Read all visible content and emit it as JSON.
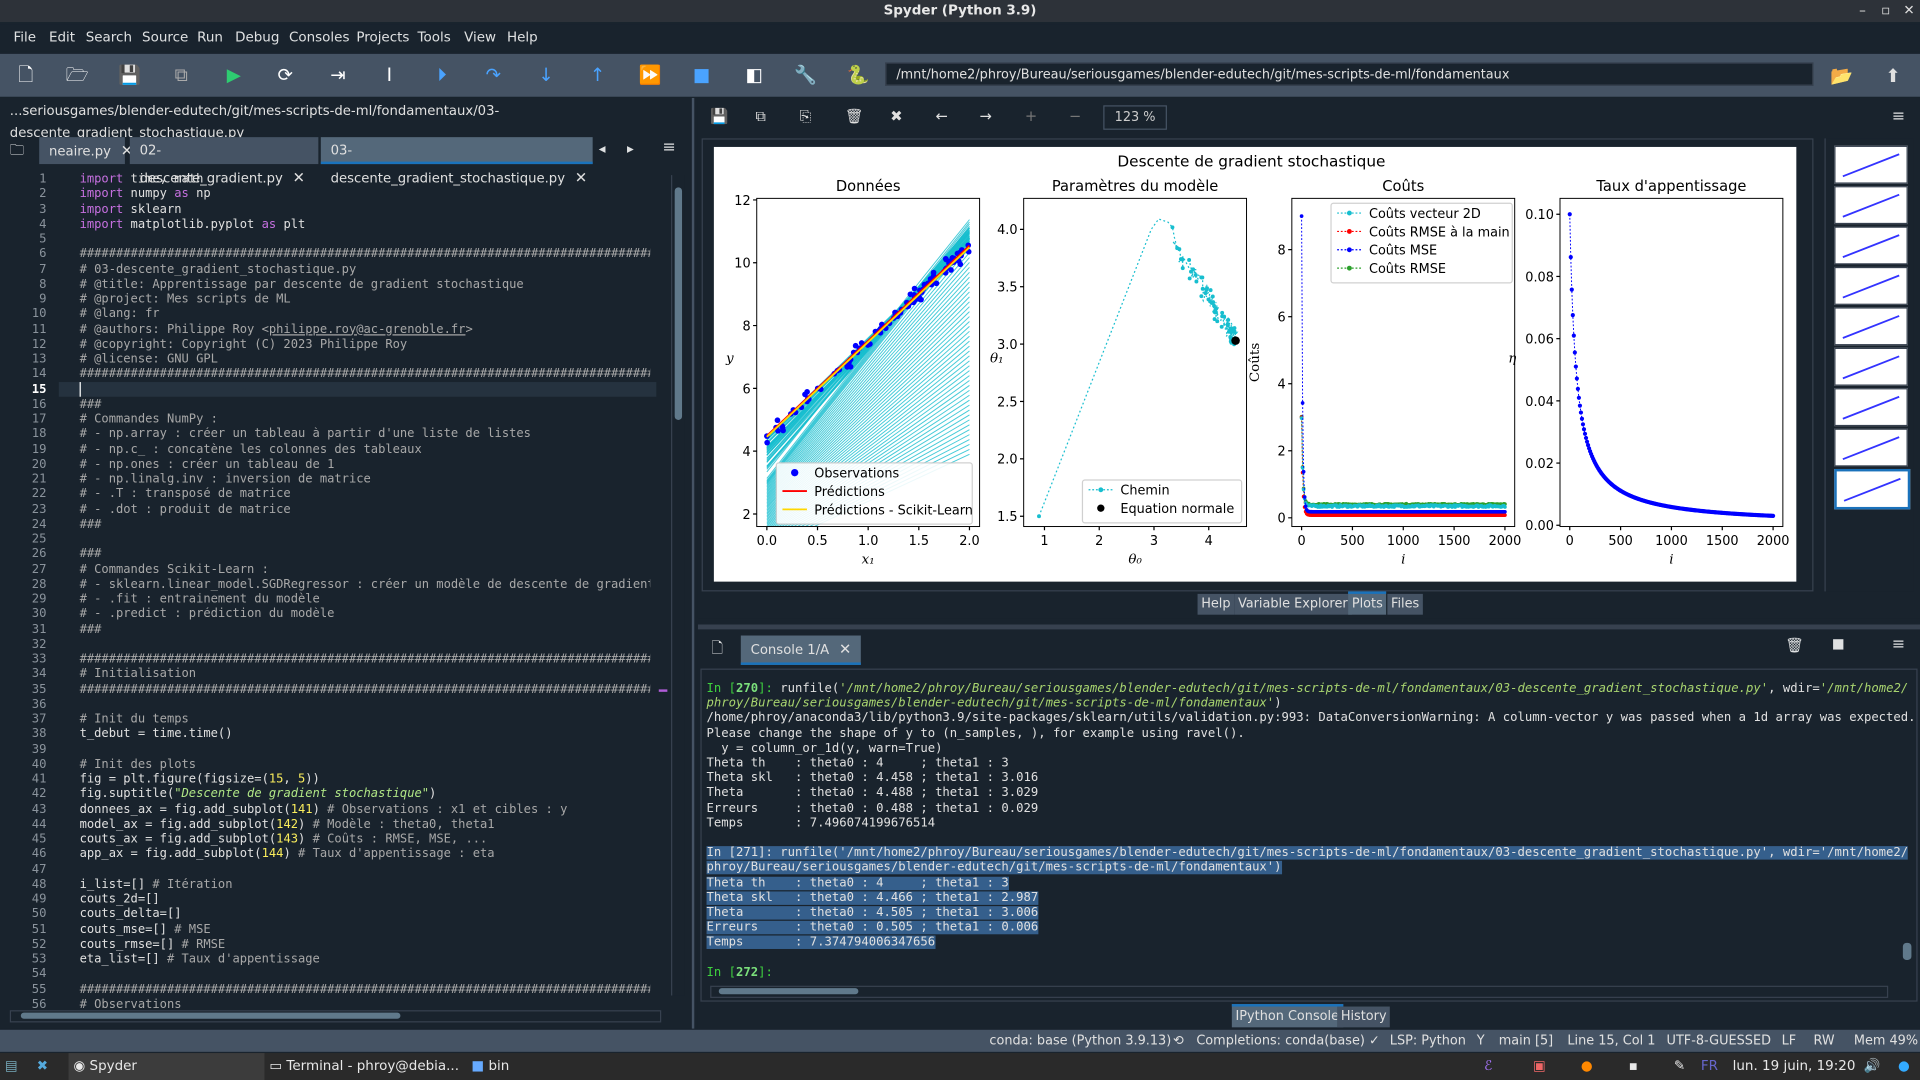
{
  "window": {
    "title": "Spyder (Python 3.9)"
  },
  "menu": [
    "File",
    "Edit",
    "Search",
    "Source",
    "Run",
    "Debug",
    "Consoles",
    "Projects",
    "Tools",
    "View",
    "Help"
  ],
  "toolbar": {
    "path": "/mnt/home2/phroy/Bureau/seriousgames/blender-edutech/git/mes-scripts-de-ml/fondamentaux",
    "icons": [
      "new-file-icon",
      "open-file-icon",
      "save-icon",
      "save-all-icon",
      "run-icon",
      "run-cell-icon",
      "run-cell-advance-icon",
      "run-selection-icon",
      "debug-icon",
      "step-icon",
      "step-into-icon",
      "step-return-icon",
      "continue-icon",
      "stop-icon",
      "maximize-pane-icon",
      "preferences-icon",
      "python-path-icon"
    ]
  },
  "editor": {
    "file_path": "...seriousgames/blender-edutech/git/mes-scripts-de-ml/fondamentaux/03-descente_gradient_stochastique.py",
    "tabs": [
      {
        "label": "neaire.py"
      },
      {
        "label": "02-descente_gradient.py"
      },
      {
        "label": "03-descente_gradient_stochastique.py",
        "active": true
      }
    ],
    "current_line": 15,
    "lines": [
      "import time, math",
      "import numpy as np",
      "import sklearn",
      "import matplotlib.pyplot as plt",
      "",
      "###############################################################################",
      "# 03-descente_gradient_stochastique.py",
      "# @title: Apprentissage par descente de gradient stochastique",
      "# @project: Mes scripts de ML",
      "# @lang: fr",
      "# @authors: Philippe Roy <philippe.roy@ac-grenoble.fr>",
      "# @copyright: Copyright (C) 2023 Philippe Roy",
      "# @license: GNU GPL",
      "###############################################################################",
      "",
      "###",
      "# Commandes NumPy :",
      "# - np.array : créer un tableau à partir d'une liste de listes",
      "# - np.c_ : concatène les colonnes des tableaux",
      "# - np.ones : créer un tableau de 1",
      "# - np.linalg.inv : inversion de matrice",
      "# - .T : transposé de matrice",
      "# - .dot : produit de matrice",
      "###",
      "",
      "###",
      "# Commandes Scikit-Learn :",
      "# - sklearn.linear_model.SGDRegressor : créer un modèle de descente de gradient",
      "# - .fit : entrainement du modèle",
      "# - .predict : prédiction du modèle",
      "###",
      "",
      "###############################################################################",
      "# Initialisation",
      "###############################################################################",
      "",
      "# Init du temps",
      "t_debut = time.time()",
      "",
      "# Init des plots",
      "fig = plt.figure(figsize=(15, 5))",
      "fig.suptitle(\"Descente de gradient stochastique\")",
      "donnees_ax = fig.add_subplot(141) # Observations : x1 et cibles : y",
      "model_ax = fig.add_subplot(142) # Modèle : theta0, theta1",
      "couts_ax = fig.add_subplot(143) # Coûts : RMSE, MSE, ...",
      "app_ax = fig.add_subplot(144) # Taux d'appentissage : eta",
      "",
      "i_list=[] # Itération",
      "couts_2d=[]",
      "couts_delta=[]",
      "couts_mse=[] # MSE",
      "couts_rmse=[] # RMSE",
      "eta_list=[] # Taux d'appentissage",
      "",
      "###############################################################################",
      "# Observations"
    ]
  },
  "plots": {
    "zoom": "123 %",
    "suptitle": "Descente de gradient stochastique",
    "axes": [
      {
        "title": "Données",
        "xlabel": "x₁",
        "ylabel": "y",
        "xlim": [
          -0.1,
          2.1
        ],
        "ylim": [
          1.6,
          12.05
        ],
        "xticks": [
          "0.0",
          "0.5",
          "1.0",
          "1.5",
          "2.0"
        ],
        "xtickv": [
          0,
          0.5,
          1,
          1.5,
          2
        ],
        "yticks": [
          "2",
          "4",
          "6",
          "8",
          "10",
          "12"
        ],
        "ytickv": [
          2,
          4,
          6,
          8,
          10,
          12
        ],
        "legend": [
          {
            "label": "Observations",
            "color": "#0000ff",
            "kind": "dot"
          },
          {
            "label": "Prédictions",
            "color": "#ff0000",
            "kind": "line"
          },
          {
            "label": "Prédictions - Scikit-Learn",
            "color": "#ffd700",
            "kind": "line"
          }
        ],
        "theta_pred": [
          4.488,
          3.029
        ],
        "theta_sklearn": [
          4.458,
          3.016
        ]
      },
      {
        "title": "Paramètres du modèle",
        "xlabel": "θ₀",
        "ylabel": "θ₁",
        "xlim": [
          0.62,
          4.69
        ],
        "ylim": [
          1.41,
          4.27
        ],
        "xticks": [
          "1",
          "2",
          "3",
          "4"
        ],
        "xtickv": [
          1,
          2,
          3,
          4
        ],
        "yticks": [
          "1.5",
          "2.0",
          "2.5",
          "3.0",
          "3.5",
          "4.0"
        ],
        "ytickv": [
          1.5,
          2,
          2.5,
          3,
          3.5,
          4
        ],
        "legend": [
          {
            "label": "Chemin",
            "color": "#17becf",
            "kind": "dotline"
          },
          {
            "label": "Equation normale",
            "color": "#000000",
            "kind": "dot"
          }
        ],
        "normal_equation": [
          4.49,
          3.03
        ]
      },
      {
        "title": "Coûts",
        "xlabel": "i",
        "ylabel": "Coûts",
        "xlim": [
          -96,
          2096
        ],
        "ylim": [
          -0.26,
          9.53
        ],
        "xticks": [
          "0",
          "500",
          "1000",
          "1500",
          "2000"
        ],
        "xtickv": [
          0,
          500,
          1000,
          1500,
          2000
        ],
        "yticks": [
          "0",
          "2",
          "4",
          "6",
          "8"
        ],
        "ytickv": [
          0,
          2,
          4,
          6,
          8
        ],
        "legend": [
          {
            "label": "Coûts vecteur 2D",
            "color": "#17becf",
            "kind": "dotline"
          },
          {
            "label": "Coûts RMSE à la main",
            "color": "#ff0000",
            "kind": "dotline"
          },
          {
            "label": "Coûts MSE",
            "color": "#0000ff",
            "kind": "dotline"
          },
          {
            "label": "Coûts RMSE",
            "color": "#2ca02c",
            "kind": "dotline"
          }
        ]
      },
      {
        "title": "Taux d'appentissage",
        "xlabel": "i",
        "ylabel": "η",
        "xlim": [
          -96,
          2096
        ],
        "ylim": [
          -0.0004,
          0.1051
        ],
        "xticks": [
          "0",
          "500",
          "1000",
          "1500",
          "2000"
        ],
        "xtickv": [
          0,
          500,
          1000,
          1500,
          2000
        ],
        "yticks": [
          "0.00",
          "0.02",
          "0.04",
          "0.06",
          "0.08",
          "0.10"
        ],
        "ytickv": [
          0,
          0.02,
          0.04,
          0.06,
          0.08,
          0.1
        ],
        "legend": []
      }
    ],
    "pane_tabs": [
      "Help",
      "Variable Explorer",
      "Plots",
      "Files"
    ],
    "active_pane_tab": "Plots"
  },
  "console": {
    "tab": "Console 1/A",
    "blocks": [
      [
        {
          "p": "In [",
          "n": "270",
          "r": "]: runfile(",
          "s": "'/mnt/home2/phroy/Bureau/seriousgames/blender-edutech/git/mes-scripts-de-ml/fondamentaux/03-descente_gradient_stochastique.py'",
          "t": ", wdir=",
          "s2": "'/mnt/home2/"
        }
      ],
      "phroy/Bureau/seriousgames/blender-edutech/git/mes-scripts-de-ml/fondamentaux')"
    ],
    "lines": [
      "/home/phroy/anaconda3/lib/python3.9/site-packages/sklearn/utils/validation.py:993: DataConversionWarning: A column-vector y was passed when a 1d array was expected.",
      "Please change the shape of y to (n_samples, ), for example using ravel().",
      "  y = column_or_1d(y, warn=True)",
      "Theta th    : theta0 : 4     ; theta1 : 3",
      "Theta skl   : theta0 : 4.458 ; theta1 : 3.016",
      "Theta       : theta0 : 4.488 ; theta1 : 3.029",
      "Erreurs     : theta0 : 0.488 ; theta1 : 0.029",
      "Temps       : 7.496074199676514"
    ],
    "run2_line1": "In [271]: runfile('/mnt/home2/phroy/Bureau/seriousgames/blender-edutech/git/mes-scripts-de-ml/fondamentaux/03-descente_gradient_stochastique.py', wdir='/mnt/home2/",
    "run2_line2": "phroy/Bureau/seriousgames/blender-edutech/git/mes-scripts-de-ml/fondamentaux')",
    "run2_out": [
      "Theta th    : theta0 : 4     ; theta1 : 3",
      "Theta skl   : theta0 : 4.466 ; theta1 : 2.987",
      "Theta       : theta0 : 4.505 ; theta1 : 3.006",
      "Erreurs     : theta0 : 0.505 ; theta1 : 0.006",
      "Temps       : 7.374794006347656"
    ],
    "prompt_p": "In [",
    "prompt_n": "272",
    "prompt_r": "]:",
    "bottom_tabs": [
      "IPython Console",
      "History"
    ]
  },
  "statusbar": {
    "env": "conda: base (Python 3.9.13)",
    "completions": "Completions: conda(base)",
    "lsp": "LSP: Python",
    "git": "main [5]",
    "position": "Line 15, Col 1",
    "encoding": "UTF-8-GUESSED",
    "eol": "LF",
    "rw": "RW",
    "mem": "Mem 49%"
  },
  "taskbar": {
    "apps": [
      "Spyder",
      "Terminal - phroy@debia...",
      "bin"
    ],
    "lang": "FR",
    "clock": "lun. 19 juin, 19:20"
  }
}
